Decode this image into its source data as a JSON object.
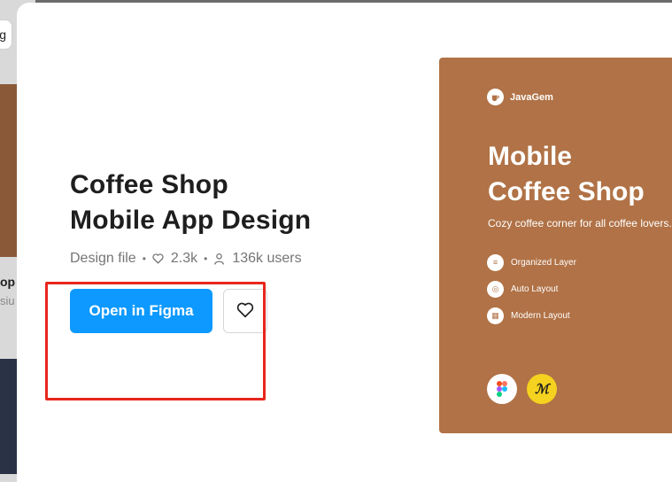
{
  "background": {
    "chip_label": "g",
    "card_title": "op M",
    "card_subtitle": "siu"
  },
  "modal": {
    "title_line1": "Coffee Shop",
    "title_line2": "Mobile App Design",
    "meta": {
      "type": "Design file",
      "likes": "2.3k",
      "users": "136k users"
    },
    "open_button_label": "Open in Figma",
    "like_button_icon": "heart-outline-icon"
  },
  "preview": {
    "brand": "JavaGem",
    "title_line1": "Mobile",
    "title_line2": "Coffee Shop",
    "tagline": "Cozy coffee corner for all coffee lovers.",
    "features": [
      "Organized Layer",
      "Auto Layout",
      "Modern Layout"
    ],
    "badges": [
      "figma-icon",
      "autolayout-icon"
    ]
  },
  "colors": {
    "primary": "#0d99ff",
    "highlight": "#e8261d",
    "preview_bg": "#b07246"
  }
}
